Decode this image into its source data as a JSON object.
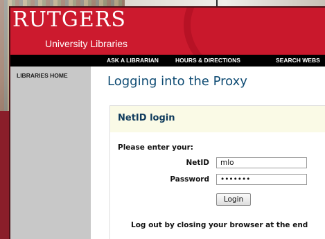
{
  "brand": {
    "logo_text": "RUTGERS",
    "sub_text": "University Libraries"
  },
  "nav": {
    "items": [
      "ASK A LIBRARIAN",
      "HOURS & DIRECTIONS",
      "SEARCH WEBS"
    ]
  },
  "sidebar": {
    "home_label": "LIBRARIES HOME"
  },
  "main": {
    "page_title": "Logging into the Proxy",
    "panel_title": "NetID login",
    "prompt": "Please enter your:",
    "netid_label": "NetID",
    "netid_value": "mlo",
    "password_label": "Password",
    "password_value": "•••••••",
    "login_button": "Login",
    "logout_note": "Log out by closing your browser at the end"
  },
  "colors": {
    "brand_red": "#cc1a2e",
    "nav_black": "#000000",
    "sidebar_gray": "#c8c8c8",
    "title_blue": "#0e4b73",
    "panel_head": "#fafae6"
  }
}
